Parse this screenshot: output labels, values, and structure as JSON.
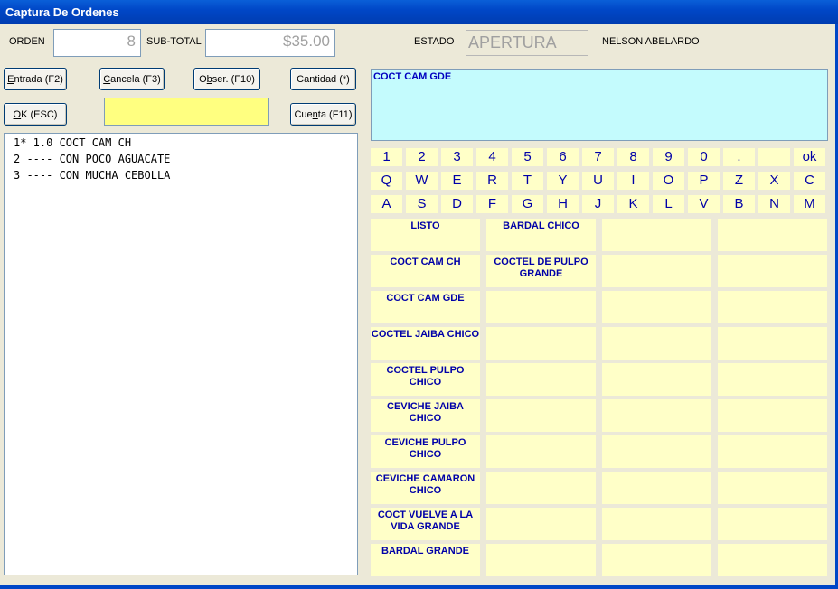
{
  "window": {
    "title": "Captura De Ordenes"
  },
  "header": {
    "orden_label": "ORDEN",
    "orden_value": "8",
    "subtotal_label": "SUB-TOTAL",
    "subtotal_value": "$35.00",
    "estado_label": "ESTADO",
    "estado_value": "APERTURA",
    "user_name": "NELSON ABELARDO"
  },
  "buttons": {
    "entrada_prefix": "E",
    "entrada_rest": "ntrada (F2)",
    "cancela_prefix": "C",
    "cancela_rest": "ancela (F3)",
    "obser_a": "O",
    "obser_b": "b",
    "obser_rest": "ser. (F10)",
    "cantidad": "Cantidad (*)",
    "ok_prefix": "O",
    "ok_rest": "K (ESC)",
    "cuenta_a": "Cue",
    "cuenta_b": "n",
    "cuenta_rest": "ta (F11)"
  },
  "order_lines": [
    "1* 1.0 COCT CAM CH",
    "2 ---- CON POCO AGUACATE",
    "3 ---- CON MUCHA CEBOLLA"
  ],
  "preview_text": "COCT CAM GDE",
  "keyboard": [
    [
      "1",
      "2",
      "3",
      "4",
      "5",
      "6",
      "7",
      "8",
      "9",
      "0",
      ".",
      "",
      "ok"
    ],
    [
      "Q",
      "W",
      "E",
      "R",
      "T",
      "Y",
      "U",
      "I",
      "O",
      "P",
      "Z",
      "X",
      "C"
    ],
    [
      "A",
      "S",
      "D",
      "F",
      "G",
      "H",
      "J",
      "K",
      "L",
      "V",
      "B",
      "N",
      "M"
    ]
  ],
  "products": [
    [
      "LISTO",
      "BARDAL CHICO",
      "",
      ""
    ],
    [
      "COCT CAM CH",
      "COCTEL DE PULPO GRANDE",
      "",
      ""
    ],
    [
      "COCT CAM GDE",
      "",
      "",
      ""
    ],
    [
      "COCTEL JAIBA CHICO",
      "",
      "",
      ""
    ],
    [
      "COCTEL PULPO CHICO",
      "",
      "",
      ""
    ],
    [
      "CEVICHE JAIBA CHICO",
      "",
      "",
      ""
    ],
    [
      "CEVICHE PULPO CHICO",
      "",
      "",
      ""
    ],
    [
      "CEVICHE CAMARON CHICO",
      "",
      "",
      ""
    ],
    [
      "COCT VUELVE A LA VIDA  GRANDE",
      "",
      "",
      ""
    ],
    [
      "BARDAL GRANDE",
      "",
      "",
      ""
    ]
  ]
}
